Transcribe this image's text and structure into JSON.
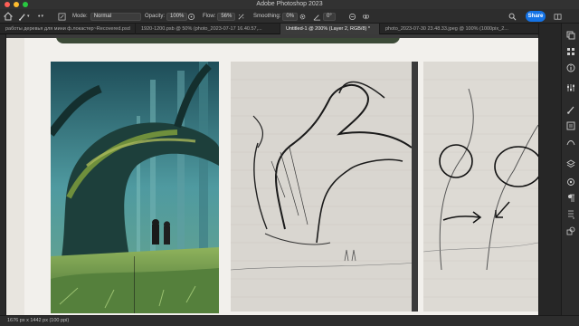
{
  "window": {
    "title": "Adobe Photoshop 2023"
  },
  "options_bar": {
    "mode_label": "Mode:",
    "mode_value": "Normal",
    "opacity_label": "Opacity:",
    "opacity_value": "100%",
    "flow_label": "Flow:",
    "flow_value": "56%",
    "smoothing_label": "Smoothing:",
    "smoothing_value": "0%",
    "angle_value": "0°",
    "share_label": "Share"
  },
  "tabs": [
    {
      "label": "работы деревья для мини ф.локастер~Recovered.psd",
      "active": false
    },
    {
      "label": "1920-1200.psb @ 50% (photo_2023-07-17 16.40.57,...",
      "active": false
    },
    {
      "label": "Untitled-1 @ 200% (Layer 2, RGB/8) *",
      "active": true
    },
    {
      "label": "photo_2023-07-30 23.48.33.jpeg @ 100% (1000pix_2...",
      "active": false
    }
  ],
  "status": {
    "text": "1676 px x 1442 px (100 ppi)"
  },
  "colors": {
    "accent": "#1473e6",
    "chrome_dark": "#2d2d2d",
    "canvas_bg": "#f2f0ec",
    "forest_teal": "#4f9aa0"
  },
  "icons": {
    "right_panel": [
      "color-icon",
      "swatches-icon",
      "info-icon",
      "adjust-icon",
      "brush-preset-icon",
      "properties-icon",
      "path-icon",
      "layers-icon",
      "channels-icon",
      "paragraph-icon",
      "history-icon",
      "shapes-icon"
    ]
  }
}
